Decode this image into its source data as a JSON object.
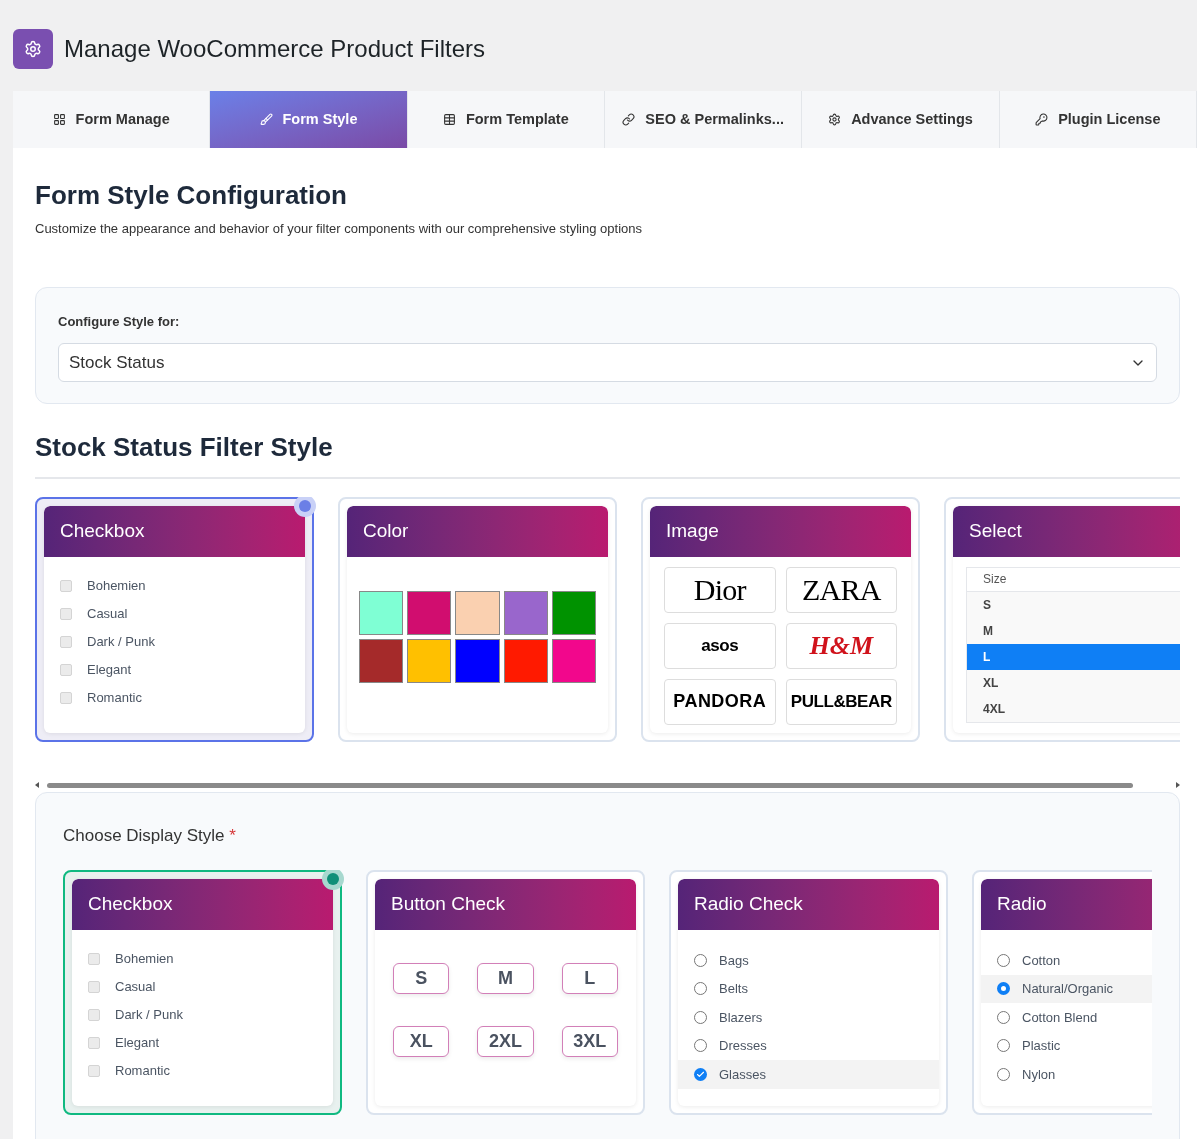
{
  "header": {
    "title": "Manage WooCommerce Product Filters"
  },
  "tabs": [
    {
      "label": "Form Manage",
      "selected": false
    },
    {
      "label": "Form Style",
      "selected": true
    },
    {
      "label": "Form Template",
      "selected": false
    },
    {
      "label": "SEO & Permalinks...",
      "selected": false
    },
    {
      "label": "Advance Settings",
      "selected": false
    },
    {
      "label": "Plugin License",
      "selected": false
    }
  ],
  "page": {
    "title": "Form Style Configuration",
    "description": "Customize the appearance and behavior of your filter components with our comprehensive styling options"
  },
  "config": {
    "label": "Configure Style for:",
    "value": "Stock Status"
  },
  "filter_style": {
    "title": "Stock Status Filter Style",
    "options": [
      {
        "kind": "checkbox",
        "title": "Checkbox",
        "selected": true,
        "items": [
          {
            "label": "Bohemien",
            "checked": false
          },
          {
            "label": "Casual",
            "checked": false
          },
          {
            "label": "Dark / Punk",
            "checked": false
          },
          {
            "label": "Elegant",
            "checked": false
          },
          {
            "label": "Romantic",
            "checked": false
          }
        ]
      },
      {
        "kind": "color",
        "title": "Color",
        "selected": false,
        "swatches": [
          {
            "color": "#7fffd4"
          },
          {
            "color": "#d10d6f"
          },
          {
            "color": "#fad0b0"
          },
          {
            "color": "#9966cc"
          },
          {
            "color": "#009200"
          },
          {
            "color": "#a52a2a"
          },
          {
            "color": "#ffc000"
          },
          {
            "color": "#0000ff"
          },
          {
            "color": "#ff1a00"
          },
          {
            "color": "#f2078c"
          }
        ]
      },
      {
        "kind": "image",
        "title": "Image",
        "selected": false,
        "brands": [
          "Dior",
          "ZARA",
          "asos",
          "H&M",
          "PANDORA",
          "PULL&BEAR"
        ]
      },
      {
        "kind": "select",
        "title": "Select",
        "selected": false,
        "header": "Size",
        "options": [
          {
            "label": "S",
            "selected": false
          },
          {
            "label": "M",
            "selected": false
          },
          {
            "label": "L",
            "selected": true
          },
          {
            "label": "XL",
            "selected": false
          },
          {
            "label": "4XL",
            "selected": false
          }
        ]
      }
    ]
  },
  "display_style": {
    "label": "Choose Display Style",
    "required_mark": "*",
    "options": [
      {
        "kind": "checkbox",
        "title": "Checkbox",
        "selected": true,
        "items": [
          {
            "label": "Bohemien",
            "checked": false
          },
          {
            "label": "Casual",
            "checked": false
          },
          {
            "label": "Dark / Punk",
            "checked": false
          },
          {
            "label": "Elegant",
            "checked": false
          },
          {
            "label": "Romantic",
            "checked": false
          }
        ]
      },
      {
        "kind": "button",
        "title": "Button Check",
        "selected": false,
        "buttons": [
          "S",
          "M",
          "L",
          "XL",
          "2XL",
          "3XL"
        ]
      },
      {
        "kind": "radio_check",
        "title": "Radio Check",
        "selected": false,
        "items": [
          {
            "label": "Bags",
            "selected": false
          },
          {
            "label": "Belts",
            "selected": false
          },
          {
            "label": "Blazers",
            "selected": false
          },
          {
            "label": "Dresses",
            "selected": false
          },
          {
            "label": "Glasses",
            "selected": true
          }
        ]
      },
      {
        "kind": "radio",
        "title": "Radio",
        "selected": false,
        "items": [
          {
            "label": "Cotton",
            "selected": false
          },
          {
            "label": "Natural/Organic",
            "selected": true
          },
          {
            "label": "Cotton Blend",
            "selected": false
          },
          {
            "label": "Plastic",
            "selected": false
          },
          {
            "label": "Nylon",
            "selected": false
          }
        ]
      }
    ]
  }
}
